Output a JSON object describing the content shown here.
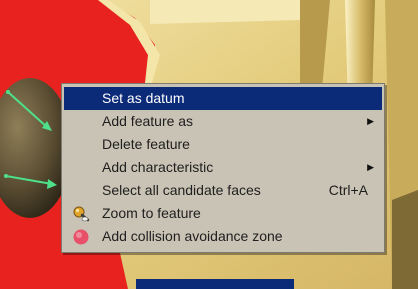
{
  "context_menu": {
    "items": [
      {
        "label": "Set as datum",
        "highlighted": true,
        "submenu": false,
        "shortcut": "",
        "icon": ""
      },
      {
        "label": "Add feature as",
        "highlighted": false,
        "submenu": true,
        "shortcut": "",
        "icon": ""
      },
      {
        "label": "Delete feature",
        "highlighted": false,
        "submenu": false,
        "shortcut": "",
        "icon": ""
      },
      {
        "label": "Add characteristic",
        "highlighted": false,
        "submenu": true,
        "shortcut": "",
        "icon": ""
      },
      {
        "label": "Select all candidate faces",
        "highlighted": false,
        "submenu": false,
        "shortcut": "Ctrl+A",
        "icon": ""
      },
      {
        "label": "Zoom to feature",
        "highlighted": false,
        "submenu": false,
        "shortcut": "",
        "icon": "zoom-feature-icon"
      },
      {
        "label": "Add collision avoidance zone",
        "highlighted": false,
        "submenu": false,
        "shortcut": "",
        "icon": "collision-zone-icon"
      }
    ],
    "submenu_arrow": "▶"
  },
  "colors": {
    "menu_background": "#c9c3b5",
    "highlight": "#0b2a78",
    "model_red": "#e8231f",
    "model_yellow": "#e9d48a",
    "vector_green": "#4fe08a"
  }
}
